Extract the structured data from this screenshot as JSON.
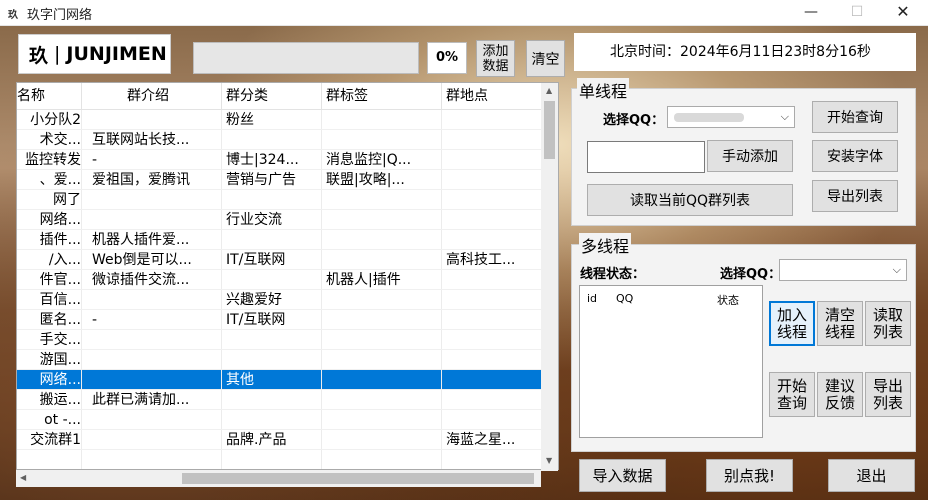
{
  "window": {
    "title": "玖字门网络",
    "min_icon": "—",
    "max_icon": "☐",
    "close_icon": "✕"
  },
  "logo": {
    "left": "玖",
    "right": "JUNJIMEN"
  },
  "progress": {
    "percent_label": "0%",
    "value": 0
  },
  "toolbar": {
    "add_data": "添加\n数据",
    "clear": "清空"
  },
  "clock": {
    "text": "北京时间：2024年6月11日23时8分16秒"
  },
  "table": {
    "columns": [
      "名称",
      "群介绍",
      "群分类",
      "群标签",
      "群地点"
    ],
    "rows": [
      [
        "小分队2",
        "",
        "粉丝",
        "",
        ""
      ],
      [
        "术交...",
        "互联网站长技...",
        "",
        "",
        ""
      ],
      [
        "监控转发",
        "-",
        "博士|324...",
        "消息监控|Q...",
        ""
      ],
      [
        "、爱...",
        "爱祖国，爱腾讯",
        "营销与广告",
        "联盟|攻略|...",
        ""
      ],
      [
        "网了",
        "",
        "",
        "",
        ""
      ],
      [
        "网络...",
        "",
        "行业交流",
        "",
        ""
      ],
      [
        "插件...",
        "机器人插件爱...",
        "",
        "",
        ""
      ],
      [
        "/入...",
        "Web倒是可以...",
        "IT/互联网",
        "",
        "高科技工..."
      ],
      [
        "件官...",
        "微谅插件交流...",
        "",
        "机器人|插件",
        ""
      ],
      [
        "百信...",
        "",
        "兴趣爱好",
        "",
        ""
      ],
      [
        "匿名...",
        "-",
        "IT/互联网",
        "",
        ""
      ],
      [
        "手交...",
        "",
        "",
        "",
        ""
      ],
      [
        "游国...",
        "",
        "",
        "",
        ""
      ],
      [
        "网络...",
        "",
        "其他",
        "",
        ""
      ],
      [
        "搬运...",
        "此群已满请加...",
        "",
        "",
        ""
      ],
      [
        "ot -...",
        "",
        "",
        "",
        ""
      ],
      [
        "交流群1",
        "",
        "品牌.产品",
        "",
        "海蓝之星..."
      ],
      [
        "",
        "",
        "",
        "",
        ""
      ]
    ],
    "selected_row": 13
  },
  "single": {
    "title": "单线程",
    "select_label": "选择QQ：",
    "btn_query": "开始查询",
    "btn_manual": "手动添加",
    "btn_font": "安装字体",
    "btn_read": "读取当前QQ群列表",
    "btn_export": "导出列表",
    "manual_input": ""
  },
  "multi": {
    "title": "多线程",
    "status_label": "线程状态：",
    "select_label": "选择QQ：",
    "list_headers": [
      "id",
      "QQ",
      "状态"
    ],
    "btn_add": "加入\n线程",
    "btn_clear": "清空\n线程",
    "btn_read": "读取\n列表",
    "btn_start": "开始\n查询",
    "btn_feedback": "建议\n反馈",
    "btn_export": "导出\n列表"
  },
  "bottom": {
    "import": "导入数据",
    "dont_click": "别点我!",
    "exit": "退出"
  }
}
